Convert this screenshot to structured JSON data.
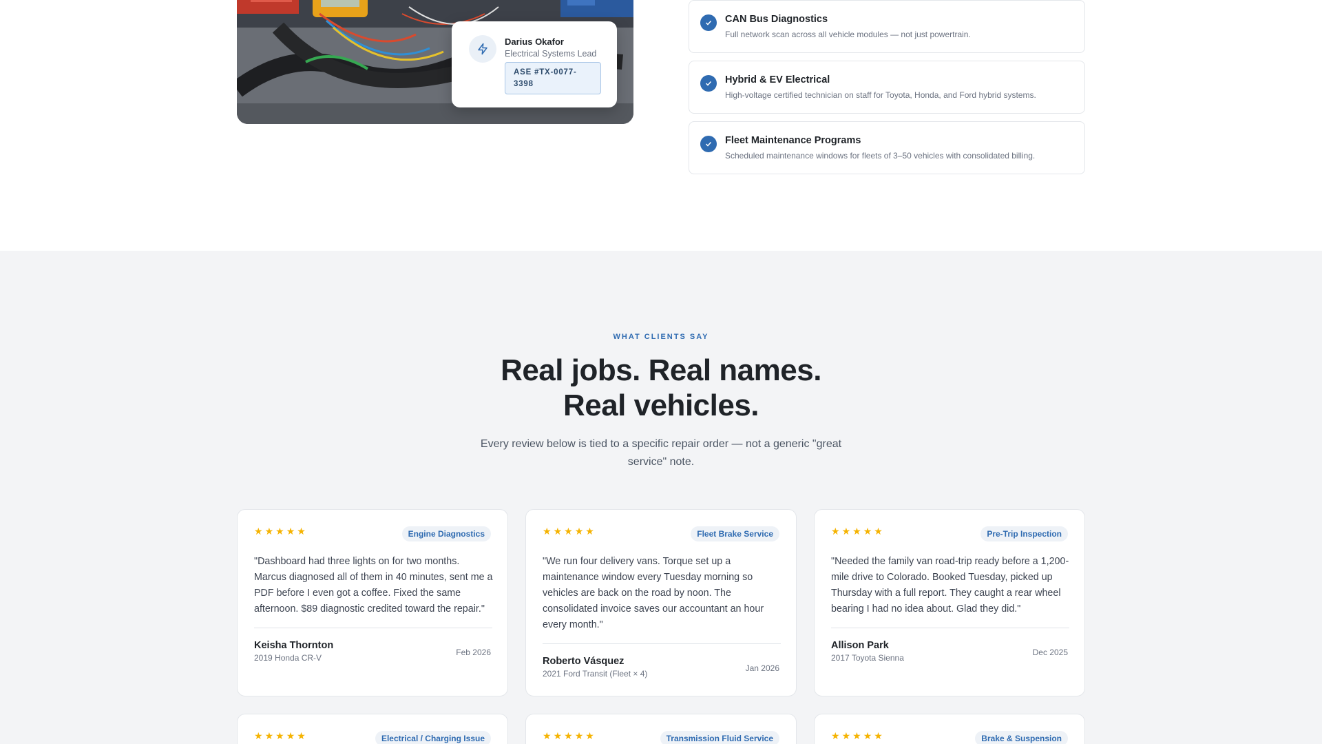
{
  "technician": {
    "name": "Darius Okafor",
    "role": "Electrical Systems Lead",
    "badge": "ASE #TX-0077-3398",
    "icon": "lightning-icon"
  },
  "features": [
    {
      "title": "CAN Bus Diagnostics",
      "description": "Full network scan across all vehicle modules — not just powertrain."
    },
    {
      "title": "Hybrid & EV Electrical",
      "description": "High-voltage certified technician on staff for Toyota, Honda, and Ford hybrid systems."
    },
    {
      "title": "Fleet Maintenance Programs",
      "description": "Scheduled maintenance windows for fleets of 3–50 vehicles with consolidated billing."
    }
  ],
  "clients": {
    "eyebrow": "WHAT CLIENTS SAY",
    "headline_line1": "Real jobs. Real names.",
    "headline_line2": "Real vehicles.",
    "subhead": "Every review below is tied to a specific repair order — not a generic \"great service\" note."
  },
  "reviews": [
    {
      "rating": 5,
      "tag": "Engine Diagnostics",
      "quote": "\"Dashboard had three lights on for two months. Marcus diagnosed all of them in 40 minutes, sent me a PDF before I even got a coffee. Fixed the same afternoon. $89 diagnostic credited toward the repair.\"",
      "name": "Keisha Thornton",
      "vehicle": "2019 Honda CR-V",
      "date": "Feb 2026"
    },
    {
      "rating": 5,
      "tag": "Fleet Brake Service",
      "quote": "\"We run four delivery vans. Torque set up a maintenance window every Tuesday morning so vehicles are back on the road by noon. The consolidated invoice saves our accountant an hour every month.\"",
      "name": "Roberto Vásquez",
      "vehicle": "2021 Ford Transit (Fleet × 4)",
      "date": "Jan 2026"
    },
    {
      "rating": 5,
      "tag": "Pre-Trip Inspection",
      "quote": "\"Needed the family van road-trip ready before a 1,200-mile drive to Colorado. Booked Tuesday, picked up Thursday with a full report. They caught a rear wheel bearing I had no idea about. Glad they did.\"",
      "name": "Allison Park",
      "vehicle": "2017 Toyota Sienna",
      "date": "Dec 2025"
    },
    {
      "rating": 5,
      "tag": "Electrical / Charging Issue"
    },
    {
      "rating": 5,
      "tag": "Transmission Fluid Service"
    },
    {
      "rating": 5,
      "tag": "Brake & Suspension"
    }
  ],
  "colors": {
    "accent": "#2f6bb1",
    "star": "#f5b301",
    "section_bg": "#f3f4f6"
  }
}
